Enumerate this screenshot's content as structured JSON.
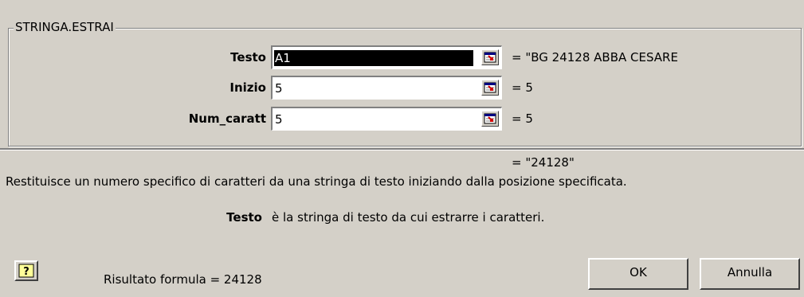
{
  "function_name": "STRINGA.ESTRAI",
  "arguments": [
    {
      "label": "Testo",
      "value": "A1",
      "selected": true,
      "result": "= \"BG  24128  ABBA CESARE"
    },
    {
      "label": "Inizio",
      "value": "5",
      "selected": false,
      "result": "= 5"
    },
    {
      "label": "Num_caratt",
      "value": "5",
      "selected": false,
      "result": "= 5"
    }
  ],
  "formula_result": "= \"24128\"",
  "description": "Restituisce un numero specifico di caratteri da una stringa di testo iniziando dalla posizione specificata.",
  "help_arg": {
    "name": "Testo",
    "text": "è la stringa di testo da cui estrarre i caratteri."
  },
  "formula_summary": "Risultato formula = 24128",
  "buttons": {
    "ok": "OK",
    "cancel": "Annulla"
  },
  "colors": {
    "dialog_bg": "#d4d0c8",
    "input_bg": "#ffffff",
    "selection_bg": "#000000"
  },
  "icons": {
    "help": "help-question-icon",
    "collapse": "collapse-dialog-icon"
  }
}
